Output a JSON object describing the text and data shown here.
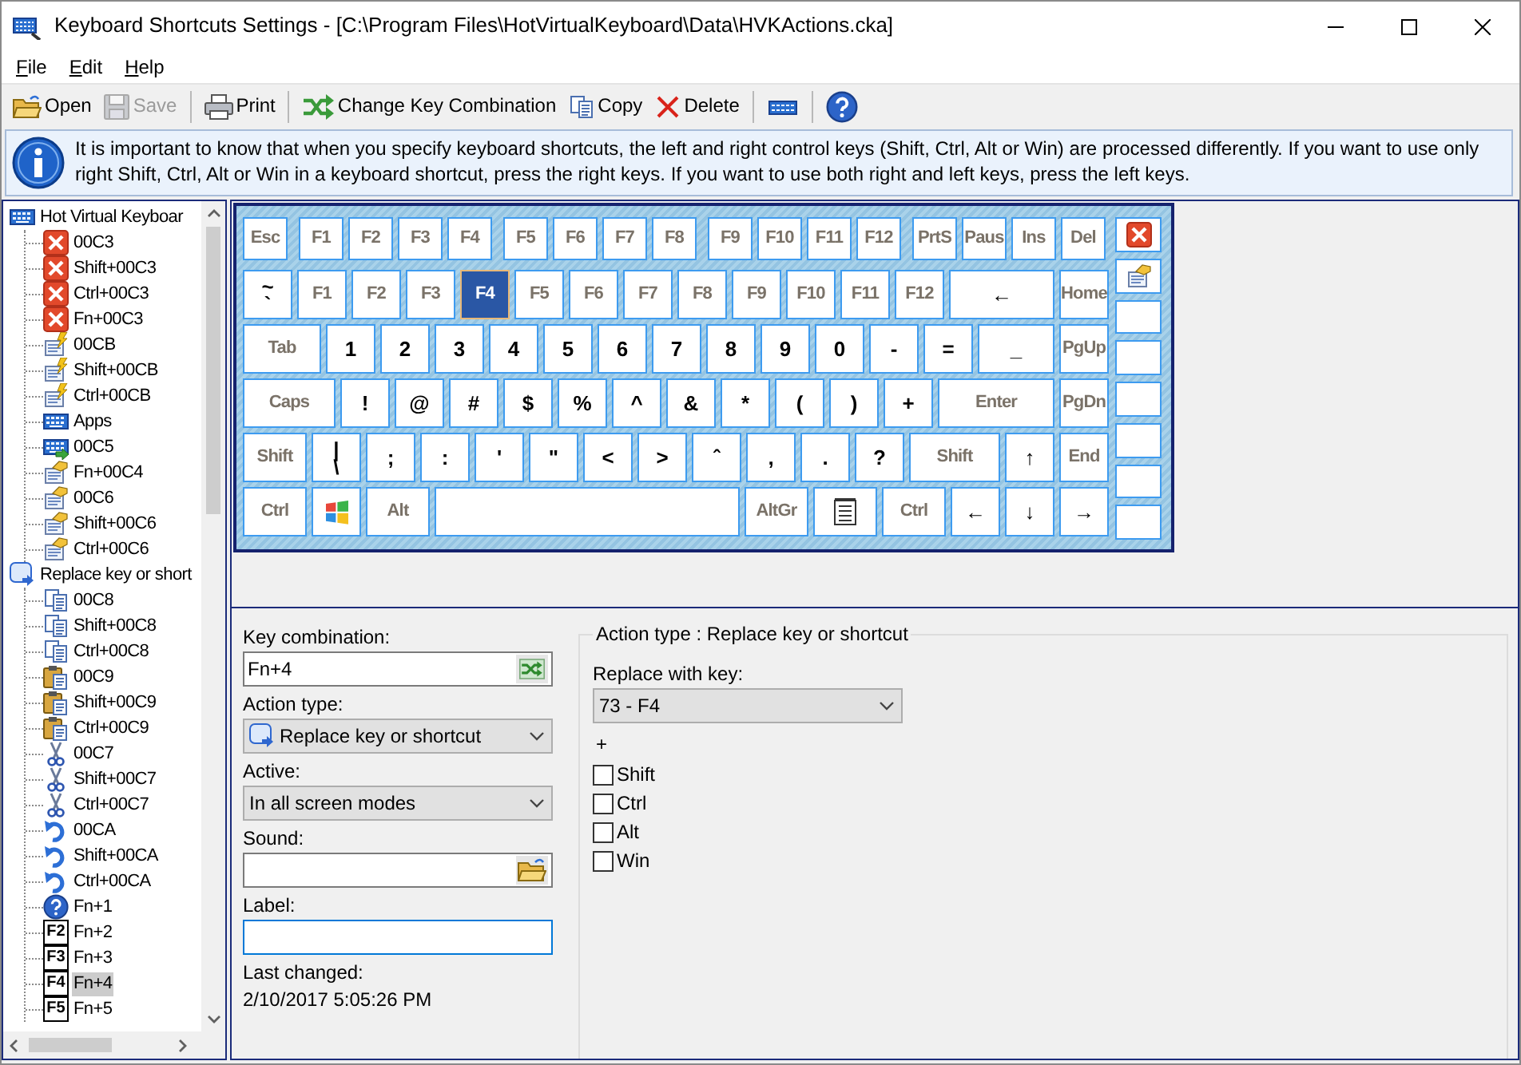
{
  "window": {
    "title": "Keyboard Shortcuts Settings - [C:\\Program Files\\HotVirtualKeyboard\\Data\\HVKActions.cka]"
  },
  "menu": [
    "File",
    "Edit",
    "Help"
  ],
  "toolbar": [
    {
      "kind": "open",
      "label": "Open",
      "disabled": false
    },
    {
      "kind": "save",
      "label": "Save",
      "disabled": true
    },
    {
      "kind": "separator"
    },
    {
      "kind": "print",
      "label": "Print",
      "disabled": false
    },
    {
      "kind": "separator"
    },
    {
      "kind": "change",
      "label": "Change Key Combination",
      "disabled": false
    },
    {
      "kind": "copy",
      "label": "Copy",
      "disabled": false
    },
    {
      "kind": "delete",
      "label": "Delete",
      "disabled": false
    },
    {
      "kind": "separator"
    },
    {
      "kind": "keyboard",
      "disabled": false
    },
    {
      "kind": "separator"
    },
    {
      "kind": "help",
      "disabled": false
    }
  ],
  "info": {
    "text": "It is important to know that when you specify keyboard shortcuts, the left and right control keys (Shift, Ctrl, Alt or Win) are processed differently. If you want to use only right Shift, Ctrl, Alt or Win in a keyboard shortcut, press the right keys. If you want to use both right and left keys, press the left keys."
  },
  "tree": [
    {
      "label": "Hot Virtual Keyboar",
      "kind": "keyboard",
      "selected": false,
      "children": [
        {
          "label": "00C3",
          "kind": "delete",
          "selected": false
        },
        {
          "label": "Shift+00C3",
          "kind": "delete",
          "selected": false
        },
        {
          "label": "Ctrl+00C3",
          "kind": "delete",
          "selected": false
        },
        {
          "label": "Fn+00C3",
          "kind": "delete",
          "selected": false
        },
        {
          "label": "00CB",
          "kind": "edit",
          "selected": false
        },
        {
          "label": "Shift+00CB",
          "kind": "edit",
          "selected": false
        },
        {
          "label": "Ctrl+00CB",
          "kind": "edit",
          "selected": false
        },
        {
          "label": "Apps",
          "kind": "keyboard",
          "selected": false
        },
        {
          "label": "00C5",
          "kind": "keyboard_arrow",
          "selected": false
        },
        {
          "label": "Fn+00C4",
          "kind": "hand",
          "selected": false
        },
        {
          "label": "00C6",
          "kind": "hand",
          "selected": false
        },
        {
          "label": "Shift+00C6",
          "kind": "hand",
          "selected": false
        },
        {
          "label": "Ctrl+00C6",
          "kind": "hand",
          "selected": false
        }
      ]
    },
    {
      "label": "Replace key or short",
      "kind": "replace",
      "selected": false,
      "children": [
        {
          "label": "00C8",
          "kind": "copy",
          "selected": false
        },
        {
          "label": "Shift+00C8",
          "kind": "copy",
          "selected": false
        },
        {
          "label": "Ctrl+00C8",
          "kind": "copy",
          "selected": false
        },
        {
          "label": "00C9",
          "kind": "paste",
          "selected": false
        },
        {
          "label": "Shift+00C9",
          "kind": "paste",
          "selected": false
        },
        {
          "label": "Ctrl+00C9",
          "kind": "paste",
          "selected": false
        },
        {
          "label": "00C7",
          "kind": "cut",
          "selected": false
        },
        {
          "label": "Shift+00C7",
          "kind": "cut",
          "selected": false
        },
        {
          "label": "Ctrl+00C7",
          "kind": "cut",
          "selected": false
        },
        {
          "label": "00CA",
          "kind": "undo",
          "selected": false
        },
        {
          "label": "Shift+00CA",
          "kind": "undo",
          "selected": false
        },
        {
          "label": "Ctrl+00CA",
          "kind": "undo",
          "selected": false
        },
        {
          "label": "Fn+1",
          "kind": "help",
          "selected": false
        },
        {
          "label": "Fn+2",
          "kind": "fkey",
          "badge": "F2",
          "selected": false
        },
        {
          "label": "Fn+3",
          "kind": "fkey",
          "badge": "F3",
          "selected": false
        },
        {
          "label": "Fn+4",
          "kind": "fkey",
          "badge": "F4",
          "selected": true
        },
        {
          "label": "Fn+5",
          "kind": "fkey",
          "badge": "F5",
          "selected": false
        }
      ]
    }
  ],
  "keyboard": {
    "rows": [
      {
        "groups": [
          [
            {
              "label": "Esc",
              "kind": "small",
              "selected": false
            }
          ],
          [
            {
              "label": "F1",
              "kind": "small",
              "selected": false
            },
            {
              "label": "F2",
              "kind": "small",
              "selected": false
            },
            {
              "label": "F3",
              "kind": "small",
              "selected": false
            },
            {
              "label": "F4",
              "kind": "small",
              "selected": false
            }
          ],
          [
            {
              "label": "F5",
              "kind": "small",
              "selected": false
            },
            {
              "label": "F6",
              "kind": "small",
              "selected": false
            },
            {
              "label": "F7",
              "kind": "small",
              "selected": false
            },
            {
              "label": "F8",
              "kind": "small",
              "selected": false
            }
          ],
          [
            {
              "label": "F9",
              "kind": "small",
              "selected": false
            },
            {
              "label": "F10",
              "kind": "small",
              "selected": false
            },
            {
              "label": "F11",
              "kind": "small",
              "selected": false
            },
            {
              "label": "F12",
              "kind": "small",
              "selected": false
            }
          ],
          [
            {
              "label": "PrtS",
              "kind": "small",
              "selected": false
            },
            {
              "label": "Paus",
              "kind": "small",
              "selected": false
            },
            {
              "label": "Ins",
              "kind": "small",
              "selected": false
            },
            {
              "label": "Del",
              "kind": "small",
              "selected": false
            }
          ]
        ]
      },
      {
        "groups": [
          [
            {
              "upper": "~",
              "label": "`",
              "kind": "char",
              "selected": false
            },
            {
              "label": "F1",
              "kind": "name",
              "selected": false
            },
            {
              "label": "F2",
              "kind": "name",
              "selected": false
            },
            {
              "label": "F3",
              "kind": "name",
              "selected": false
            },
            {
              "label": "F4",
              "kind": "name",
              "selected": true
            },
            {
              "label": "F5",
              "kind": "name",
              "selected": false
            },
            {
              "label": "F6",
              "kind": "name",
              "selected": false
            },
            {
              "label": "F7",
              "kind": "name",
              "selected": false
            },
            {
              "label": "F8",
              "kind": "name",
              "selected": false
            },
            {
              "label": "F9",
              "kind": "name",
              "selected": false
            },
            {
              "label": "F10",
              "kind": "name",
              "selected": false
            },
            {
              "label": "F11",
              "kind": "name",
              "selected": false
            },
            {
              "label": "F12",
              "kind": "name",
              "selected": false
            },
            {
              "label": "←",
              "kind": "fill_char",
              "selected": false
            },
            {
              "label": "Home",
              "kind": "name",
              "selected": false
            }
          ]
        ]
      },
      {
        "groups": [
          [
            {
              "label": "Tab",
              "kind": "tab",
              "selected": false
            },
            {
              "label": "1",
              "kind": "char",
              "selected": false
            },
            {
              "label": "2",
              "kind": "char",
              "selected": false
            },
            {
              "label": "3",
              "kind": "char",
              "selected": false
            },
            {
              "label": "4",
              "kind": "char",
              "selected": false
            },
            {
              "label": "5",
              "kind": "char",
              "selected": false
            },
            {
              "label": "6",
              "kind": "char",
              "selected": false
            },
            {
              "label": "7",
              "kind": "char",
              "selected": false
            },
            {
              "label": "8",
              "kind": "char",
              "selected": false
            },
            {
              "label": "9",
              "kind": "char",
              "selected": false
            },
            {
              "label": "0",
              "kind": "char",
              "selected": false
            },
            {
              "label": "-",
              "kind": "char",
              "selected": false
            },
            {
              "label": "=",
              "kind": "char",
              "selected": false
            },
            {
              "label": "_",
              "kind": "fill_char",
              "selected": false
            },
            {
              "label": "PgUp",
              "kind": "name",
              "selected": false
            }
          ]
        ]
      },
      {
        "groups": [
          [
            {
              "label": "Caps",
              "kind": "caps",
              "selected": false
            },
            {
              "label": "!",
              "kind": "char",
              "selected": false
            },
            {
              "label": "@",
              "kind": "char",
              "selected": false
            },
            {
              "label": "#",
              "kind": "char",
              "selected": false
            },
            {
              "label": "$",
              "kind": "char",
              "selected": false
            },
            {
              "label": "%",
              "kind": "char",
              "selected": false
            },
            {
              "label": "^",
              "kind": "char",
              "selected": false
            },
            {
              "label": "&",
              "kind": "char",
              "selected": false
            },
            {
              "label": "*",
              "kind": "char",
              "selected": false
            },
            {
              "label": "(",
              "kind": "char",
              "selected": false
            },
            {
              "label": ")",
              "kind": "char",
              "selected": false
            },
            {
              "label": "+",
              "kind": "char",
              "selected": false
            },
            {
              "label": "Enter",
              "kind": "fill_name",
              "selected": false
            },
            {
              "label": "PgDn",
              "kind": "name",
              "selected": false
            }
          ]
        ]
      },
      {
        "groups": [
          [
            {
              "label": "Shift",
              "kind": "wide_name",
              "selected": false
            },
            {
              "upper": "|",
              "label": "\\",
              "kind": "char",
              "selected": false
            },
            {
              "label": ";",
              "kind": "char",
              "selected": false
            },
            {
              "label": ":",
              "kind": "char",
              "selected": false
            },
            {
              "label": "'",
              "kind": "char",
              "selected": false
            },
            {
              "label": "\"",
              "kind": "char",
              "selected": false
            },
            {
              "label": "<",
              "kind": "char",
              "selected": false
            },
            {
              "label": ">",
              "kind": "char",
              "selected": false
            },
            {
              "label": "ˆ",
              "kind": "char",
              "selected": false
            },
            {
              "label": ",",
              "kind": "char",
              "selected": false
            },
            {
              "label": ".",
              "kind": "char",
              "selected": false
            },
            {
              "label": "?",
              "kind": "char",
              "selected": false
            },
            {
              "label": "Shift",
              "kind": "fill_name",
              "selected": false
            },
            {
              "label": "↑",
              "kind": "char",
              "selected": false
            },
            {
              "label": "End",
              "kind": "name",
              "selected": false
            }
          ]
        ]
      },
      {
        "groups": [
          [
            {
              "label": "Ctrl",
              "kind": "wide_name",
              "selected": false
            },
            {
              "kind": "win_key",
              "selected": false
            },
            {
              "label": "Alt",
              "kind": "wide_name",
              "selected": false
            },
            {
              "kind": "space",
              "selected": false
            },
            {
              "label": "AltGr",
              "kind": "wide_name",
              "selected": false
            },
            {
              "kind": "menu_key",
              "selected": false
            },
            {
              "label": "Ctrl",
              "kind": "wide_name",
              "selected": false
            },
            {
              "label": "←",
              "kind": "char",
              "selected": false
            },
            {
              "label": "↓",
              "kind": "char",
              "selected": false
            },
            {
              "label": "→",
              "kind": "char",
              "selected": false
            }
          ]
        ]
      }
    ],
    "side_buttons": [
      {
        "kind": "delete"
      },
      {
        "kind": "properties"
      },
      {
        "kind": "blank"
      },
      {
        "kind": "blank"
      },
      {
        "kind": "blank"
      },
      {
        "kind": "blank"
      },
      {
        "kind": "blank"
      },
      {
        "kind": "blank"
      }
    ]
  },
  "form": {
    "key_combination": {
      "label": "Key combination:",
      "value": "Fn+4"
    },
    "action_type": {
      "label": "Action type:",
      "value": "Replace key or shortcut"
    },
    "active": {
      "label": "Active:",
      "value": "In all screen modes"
    },
    "sound": {
      "label": "Sound:"
    },
    "label_field": {
      "label": "Label:",
      "focused": true
    },
    "last_changed": {
      "label": "Last changed:",
      "value": "2/10/2017 5:05:26 PM"
    }
  },
  "action_group": {
    "title": "Action type : Replace key or shortcut",
    "replace_label": "Replace with key:",
    "replace_value": "73 - F4",
    "plus": "+",
    "modifiers": [
      {
        "label": "Shift",
        "checked": false
      },
      {
        "label": "Ctrl",
        "checked": false
      },
      {
        "label": "Alt",
        "checked": false
      },
      {
        "label": "Win",
        "checked": false
      }
    ]
  }
}
